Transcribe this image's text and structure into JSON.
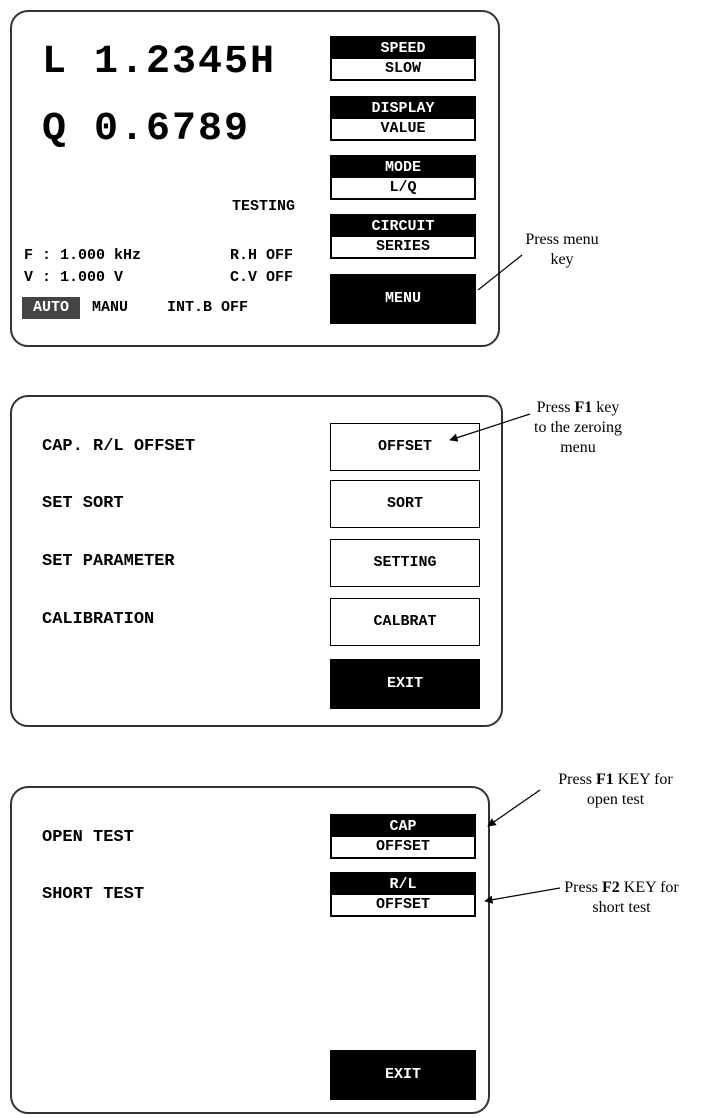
{
  "panel1": {
    "l_reading": "L 1.2345H",
    "q_reading": "Q 0.6789",
    "status": "TESTING",
    "freq": "F : 1.000 kHz",
    "rh": "R.H OFF",
    "volt": "V : 1.000 V",
    "cv": "C.V OFF",
    "auto": "AUTO",
    "manu": "MANU",
    "intb": "INT.B OFF",
    "keys": [
      {
        "title": "SPEED",
        "value": "SLOW"
      },
      {
        "title": "DISPLAY",
        "value": "VALUE"
      },
      {
        "title": "MODE",
        "value": "L/Q"
      },
      {
        "title": "CIRCUIT",
        "value": "SERIES"
      }
    ],
    "menu": "MENU",
    "annotation_line1": "Press menu",
    "annotation_line2": "key"
  },
  "panel2": {
    "items": [
      {
        "label": "CAP. R/L OFFSET",
        "key": "OFFSET"
      },
      {
        "label": "SET SORT",
        "key": "SORT"
      },
      {
        "label": "SET PARAMETER",
        "key": "SETTING"
      },
      {
        "label": "CALIBRATION",
        "key": "CALBRAT"
      }
    ],
    "exit": "EXIT",
    "annotation_pre": "Press ",
    "annotation_key": "F1",
    "annotation_post": " key",
    "annotation_line2": "to the zeroing",
    "annotation_line3": "menu"
  },
  "panel3": {
    "open_label": "OPEN TEST",
    "short_label": "SHORT TEST",
    "cap_title": "CAP",
    "cap_value": "OFFSET",
    "rl_title": "R/L",
    "rl_value": "OFFSET",
    "exit": "EXIT",
    "ann1_pre": "Press ",
    "ann1_key": "F1",
    "ann1_post": " KEY for",
    "ann1_line2": "open test",
    "ann2_pre": "Press ",
    "ann2_key": "F2",
    "ann2_post": " KEY for",
    "ann2_line2": "short test"
  }
}
